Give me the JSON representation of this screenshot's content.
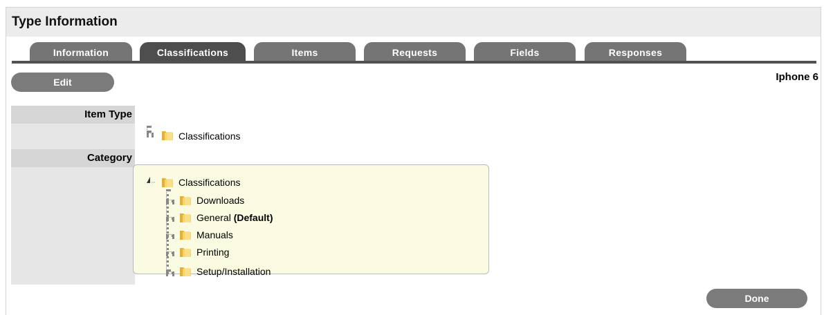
{
  "header": {
    "title": "Type Information"
  },
  "tabs": [
    {
      "label": "Information",
      "active": false
    },
    {
      "label": "Classifications",
      "active": true
    },
    {
      "label": "Items",
      "active": false
    },
    {
      "label": "Requests",
      "active": false
    },
    {
      "label": "Fields",
      "active": false
    },
    {
      "label": "Responses",
      "active": false
    }
  ],
  "toolbar": {
    "edit_label": "Edit",
    "item_name": "Iphone 6"
  },
  "form": {
    "item_type_label": "Item Type",
    "category_label": "Category"
  },
  "item_type_tree": {
    "root": "Classifications"
  },
  "category_tree": {
    "root": "Classifications",
    "children": [
      {
        "label": "Downloads",
        "suffix": ""
      },
      {
        "label": "General",
        "suffix": "(Default)"
      },
      {
        "label": "Manuals",
        "suffix": ""
      },
      {
        "label": "Printing",
        "suffix": ""
      },
      {
        "label": "Setup/Installation",
        "suffix": ""
      }
    ]
  },
  "footer": {
    "done_label": "Done"
  },
  "icons": {
    "folder": "folder-icon",
    "tree_toggle": "tree-expand-icon"
  },
  "colors": {
    "tab": "#757575",
    "tab_active": "#4e4e4e",
    "tree_bg": "#fbfbe2",
    "folder": "#f2c94c"
  }
}
